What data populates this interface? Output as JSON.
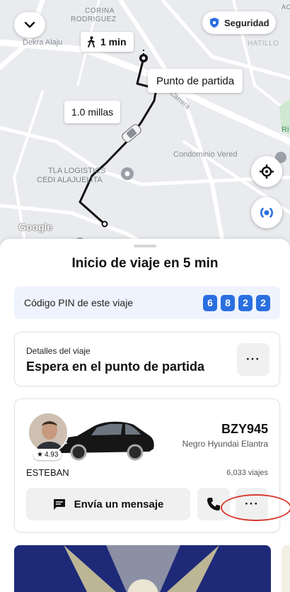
{
  "map": {
    "labels": {
      "corina": "CORINA",
      "rodriguez": "RODRIGUEZ",
      "dekra": "Dekra Alaju",
      "hatillo": "HATILLO",
      "carrera": "Carrera",
      "condominio": "Condominio Vered",
      "tla_line1": "TLA LOGISTICS",
      "tla_line2": "CEDI ALAJUELITA",
      "ri": "Ri",
      "ac": "AC"
    },
    "security_label": "Seguridad",
    "walk_time": "1 min",
    "pickup_label": "Punto de partida",
    "distance_label": "1.0 millas",
    "google_label": "Google"
  },
  "sheet": {
    "title": "Inicio de viaje en 5 min",
    "pin": {
      "label": "Código PIN de este viaje",
      "digits": [
        "6",
        "8",
        "2",
        "2"
      ]
    },
    "trip": {
      "subtitle": "Detalles del viaje",
      "status": "Espera en el punto de partida",
      "more": "···"
    },
    "driver": {
      "rating": "4.93",
      "plate": "BZY945",
      "car": "Negro Hyundai Elantra",
      "name": "ESTEBAN",
      "trips": "6,033 viajes",
      "message_label": "Envía un mensaje",
      "more": "···"
    }
  },
  "colors": {
    "accent": "#2a6fe0",
    "route": "#111111",
    "annotation": "#d9382c"
  },
  "icons": {
    "collapse": "chevron-down-icon",
    "security": "shield-icon",
    "walk": "walking-person-icon",
    "recenter": "crosshair-icon",
    "safety": "broadcast-icon",
    "message": "chat-bubble-icon",
    "call": "phone-icon",
    "star": "star-icon"
  }
}
